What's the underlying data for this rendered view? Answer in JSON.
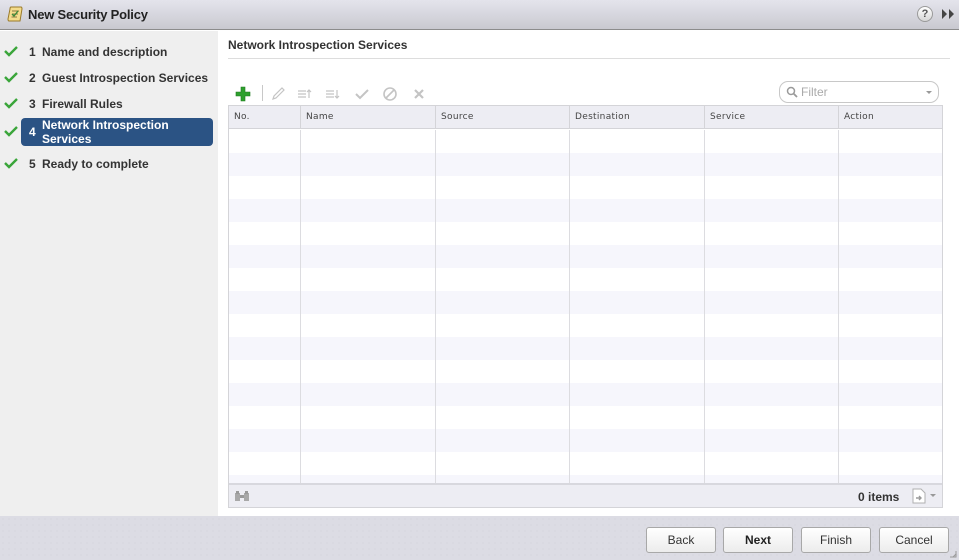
{
  "window": {
    "title": "New Security Policy",
    "icons": {
      "app": "policy-scroll-icon",
      "help": "help-icon",
      "expand": "double-chevron-right-icon"
    },
    "help_glyph": "?"
  },
  "sidebar": {
    "steps": [
      {
        "number": "1",
        "label": "Name and description",
        "completed": true,
        "active": false
      },
      {
        "number": "2",
        "label": "Guest Introspection Services",
        "completed": true,
        "active": false
      },
      {
        "number": "3",
        "label": "Firewall Rules",
        "completed": true,
        "active": false
      },
      {
        "number": "4",
        "label": "Network Introspection Services",
        "completed": true,
        "active": true
      },
      {
        "number": "5",
        "label": "Ready to complete",
        "completed": true,
        "active": false
      }
    ]
  },
  "main": {
    "heading": "Network Introspection Services",
    "toolbar": {
      "buttons": [
        {
          "name": "add",
          "icon": "plus-icon",
          "enabled": true
        },
        {
          "name": "edit",
          "icon": "pencil-icon",
          "enabled": false
        },
        {
          "name": "move-up",
          "icon": "move-up-icon",
          "enabled": false
        },
        {
          "name": "move-down",
          "icon": "move-down-icon",
          "enabled": false
        },
        {
          "name": "enable",
          "icon": "checkmark-icon",
          "enabled": false
        },
        {
          "name": "disable",
          "icon": "prohibit-icon",
          "enabled": false
        },
        {
          "name": "delete",
          "icon": "x-icon",
          "enabled": false
        }
      ]
    },
    "filter": {
      "placeholder": "Filter",
      "value": ""
    },
    "table": {
      "columns": [
        "No.",
        "Name",
        "Source",
        "Destination",
        "Service",
        "Action"
      ],
      "rows": [],
      "item_count": "0 items"
    }
  },
  "footer": {
    "buttons": {
      "back": "Back",
      "next": "Next",
      "finish": "Finish",
      "cancel": "Cancel"
    }
  },
  "colors": {
    "active_step_bg": "#2b5384",
    "check_green": "#3aa53a",
    "add_green": "#2ea02e"
  }
}
